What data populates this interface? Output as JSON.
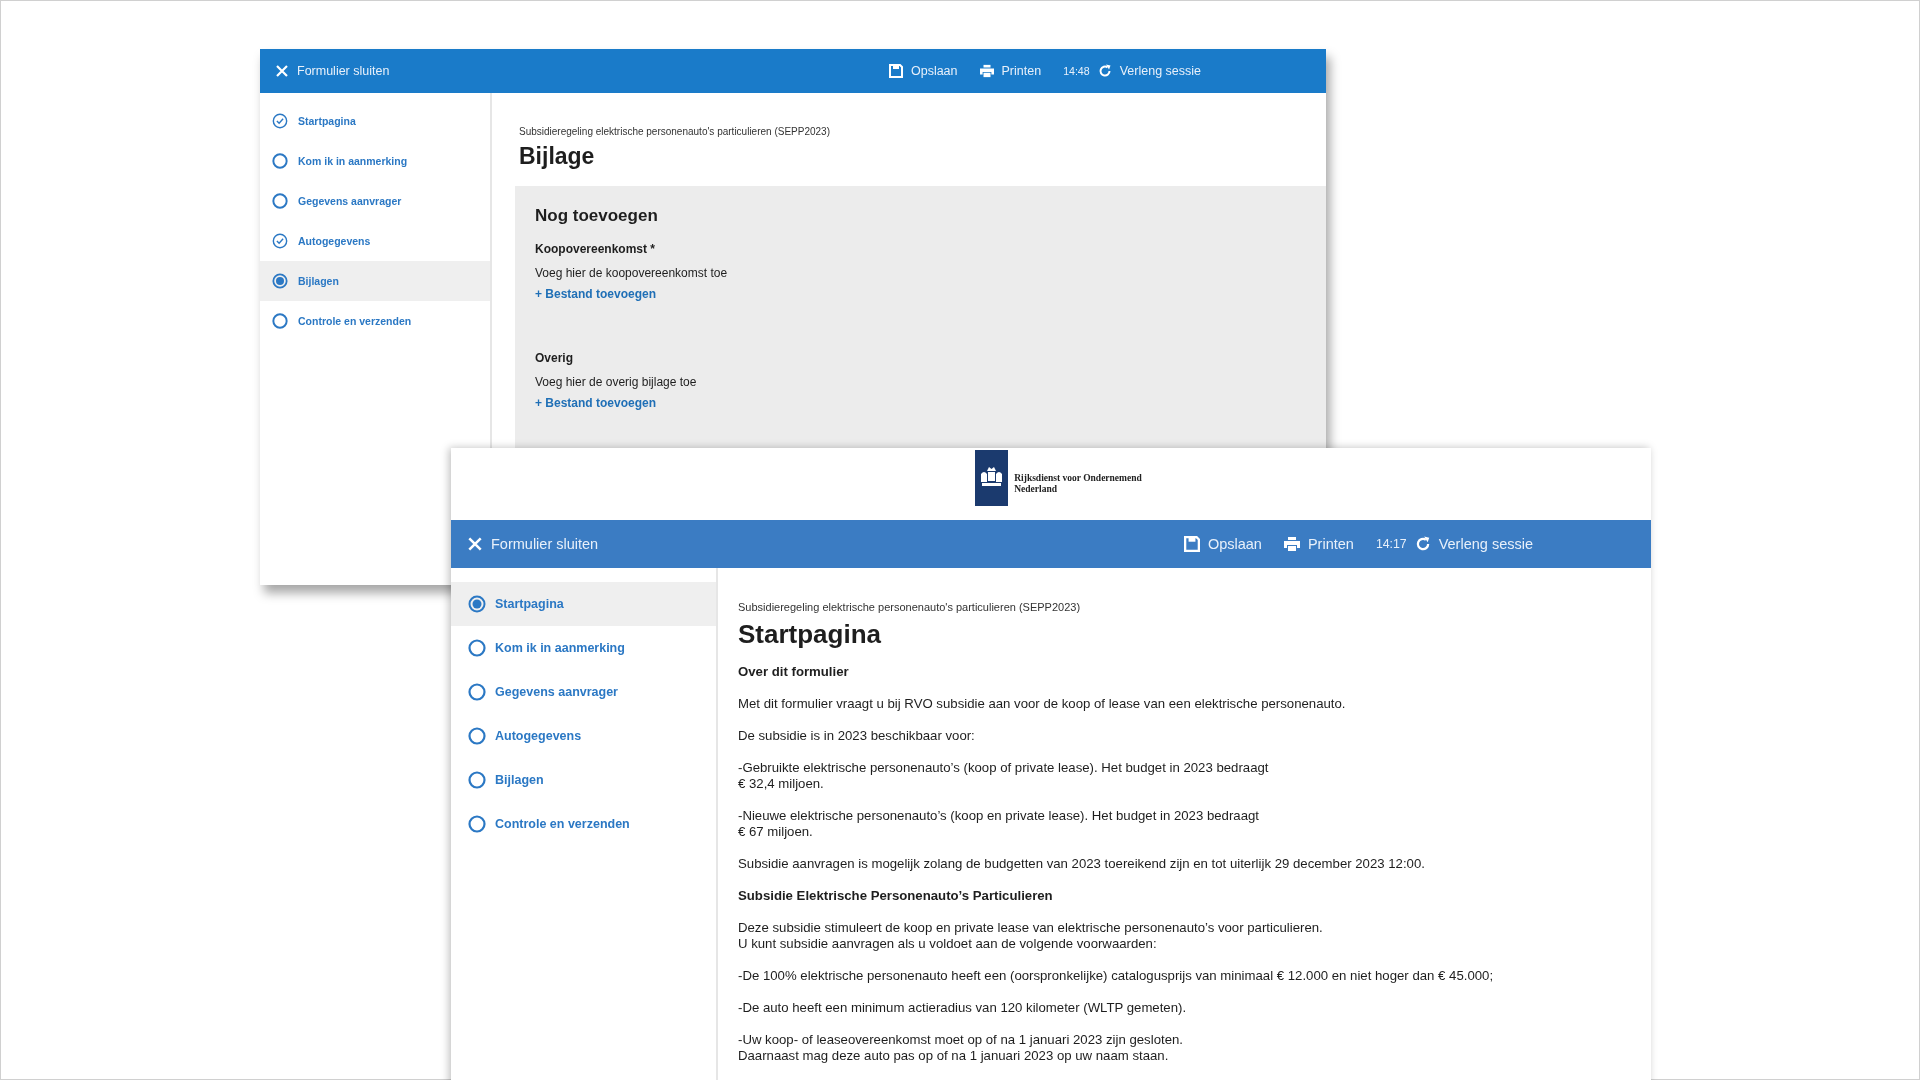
{
  "back_window": {
    "header": {
      "close_label": "Formulier sluiten",
      "save_label": "Opslaan",
      "print_label": "Printen",
      "time": "14:48",
      "extend_label": "Verleng sessie"
    },
    "sidebar": {
      "items": [
        {
          "label": "Startpagina",
          "kind": "done",
          "selected": false
        },
        {
          "label": "Kom ik in aanmerking",
          "kind": "open",
          "selected": false
        },
        {
          "label": "Gegevens aanvrager",
          "kind": "open",
          "selected": false
        },
        {
          "label": "Autogegevens",
          "kind": "done",
          "selected": false
        },
        {
          "label": "Bijlagen",
          "kind": "current",
          "selected": true
        },
        {
          "label": "Controle en verzenden",
          "kind": "open",
          "selected": false
        }
      ]
    },
    "content": {
      "subtitle": "Subsidieregeling elektrische personenauto's particulieren (SEPP2023)",
      "title": "Bijlage",
      "panel": {
        "title": "Nog toevoegen",
        "sections": [
          {
            "label": "Koopovereenkomst *",
            "hint": "Voeg hier de koopovereenkomst toe",
            "add_link": "+ Bestand toevoegen"
          },
          {
            "label": "Overig",
            "hint": "Voeg hier de overig bijlage toe",
            "add_link": "+ Bestand toevoegen"
          }
        ]
      }
    }
  },
  "front_window": {
    "logo": {
      "lines": [
        "Rijksdienst voor Ondernemend",
        "Nederland"
      ]
    },
    "header": {
      "close_label": "Formulier sluiten",
      "save_label": "Opslaan",
      "print_label": "Printen",
      "time": "14:17",
      "extend_label": "Verleng sessie"
    },
    "sidebar": {
      "items": [
        {
          "label": "Startpagina",
          "kind": "current",
          "selected": true
        },
        {
          "label": "Kom ik in aanmerking",
          "kind": "open",
          "selected": false
        },
        {
          "label": "Gegevens aanvrager",
          "kind": "open",
          "selected": false
        },
        {
          "label": "Autogegevens",
          "kind": "open",
          "selected": false
        },
        {
          "label": "Bijlagen",
          "kind": "open",
          "selected": false
        },
        {
          "label": "Controle en verzenden",
          "kind": "open",
          "selected": false
        }
      ]
    },
    "content": {
      "subtitle": "Subsidieregeling elektrische personenauto's particulieren (SEPP2023)",
      "title": "Startpagina",
      "blocks": [
        {
          "kind": "heading",
          "lines": [
            "Over dit formulier"
          ]
        },
        {
          "kind": "paragraph",
          "lines": [
            "Met dit formulier vraagt u bij RVO subsidie aan voor de koop of lease van een elektrische personenauto."
          ]
        },
        {
          "kind": "paragraph",
          "lines": [
            "De subsidie is in 2023 beschikbaar voor:"
          ]
        },
        {
          "kind": "paragraph",
          "lines": [
            "-Gebruikte elektrische personenauto’s (koop of private lease). Het budget in 2023 bedraagt",
            "€ 32,4 miljoen."
          ]
        },
        {
          "kind": "paragraph",
          "lines": [
            "-Nieuwe elektrische personenauto’s (koop en private lease). Het budget in 2023 bedraagt",
            "€ 67 miljoen."
          ]
        },
        {
          "kind": "paragraph",
          "lines": [
            "Subsidie aanvragen is mogelijk zolang de budgetten van 2023 toereikend zijn en tot uiterlijk 29 december 2023 12:00."
          ]
        },
        {
          "kind": "heading",
          "lines": [
            "Subsidie Elektrische Personenauto’s Particulieren"
          ]
        },
        {
          "kind": "paragraph",
          "lines": [
            "Deze subsidie stimuleert de koop en private lease van elektrische personenauto’s voor particulieren.",
            "U kunt subsidie aanvragen als u voldoet aan de volgende voorwaarden:"
          ]
        },
        {
          "kind": "paragraph",
          "lines": [
            "-De 100% elektrische personenauto heeft een (oorspronkelijke) catalogusprijs van minimaal € 12.000 en niet hoger dan € 45.000;"
          ]
        },
        {
          "kind": "paragraph",
          "lines": [
            "-De auto heeft een minimum actieradius van 120 kilometer (WLTP gemeten)."
          ]
        },
        {
          "kind": "paragraph",
          "lines": [
            "-Uw koop- of leaseovereenkomst moet op of na 1 januari 2023 zijn gesloten.",
            "Daarnaast mag deze auto pas op of na 1 januari 2023 op uw naam staan."
          ]
        }
      ]
    }
  }
}
